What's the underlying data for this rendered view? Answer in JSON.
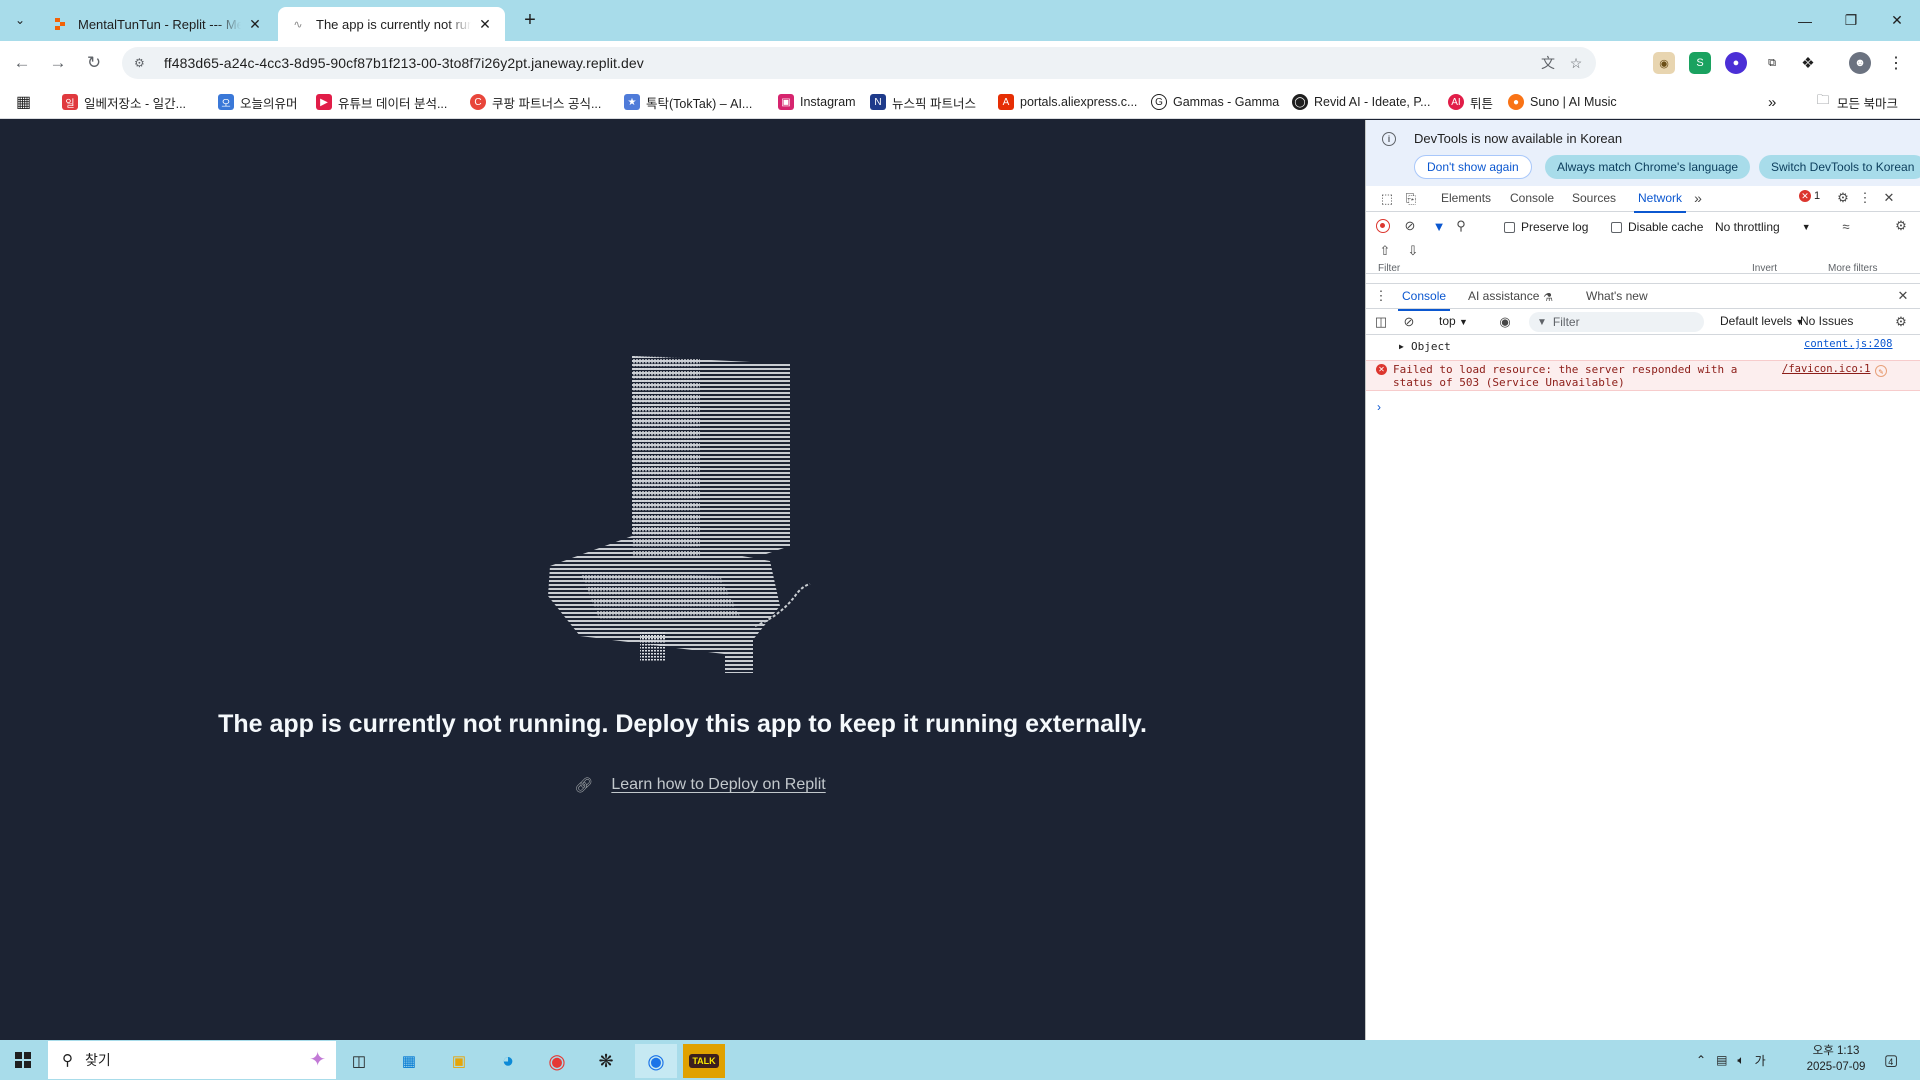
{
  "browser": {
    "tabs": [
      {
        "title": "MentalTunTun - Replit --- MentalTunTun",
        "active": false
      },
      {
        "title": "The app is currently not running",
        "active": true
      }
    ],
    "url": "ff483d65-a24c-4cc3-8d95-90cf87b1f213-00-3to8f7i26y2pt.janeway.replit.dev",
    "bookmarks": [
      "일베저장소 - 일간...",
      "오늘의유머",
      "유튜브 데이터 분석...",
      "쿠팡 파트너스 공식...",
      "톡탁(TokTak) – AI...",
      "Instagram",
      "뉴스픽 파트너스",
      "portals.aliexpress.c...",
      "Gammas - Gamma",
      "Revid AI - Ideate, P...",
      "튀튼",
      "Suno | AI Music"
    ],
    "bookmarks_folder": "모든 북마크"
  },
  "page": {
    "message": "The app is currently not running. Deploy this app to keep it running externally.",
    "link_text": "Learn how to Deploy on Replit"
  },
  "devtools": {
    "banner": {
      "text": "DevTools is now available in Korean",
      "buttons": [
        "Don't show again",
        "Always match Chrome's language",
        "Switch DevTools to Korean"
      ]
    },
    "tabs": [
      "Elements",
      "Console",
      "Sources",
      "Network"
    ],
    "active_tab": "Network",
    "error_count": "1",
    "network": {
      "preserve_log": "Preserve log",
      "disable_cache": "Disable cache",
      "throttling": "No throttling",
      "filter_placeholder": "Filter",
      "invert": "Invert",
      "more_filters": "More filters"
    },
    "drawer_tabs": [
      "Console",
      "AI assistance",
      "What's new"
    ],
    "console": {
      "context": "top",
      "filter_placeholder": "Filter",
      "levels": "Default levels",
      "issues": "No Issues",
      "messages": [
        {
          "type": "log",
          "text": "Object",
          "source": "content.js:208"
        },
        {
          "type": "error",
          "text": "Failed to load resource: the server responded with a status of 503 (Service Unavailable)",
          "source": "/favicon.ico:1"
        }
      ]
    }
  },
  "taskbar": {
    "search_placeholder": "찾기",
    "ime": "가",
    "time": "오후 1:13",
    "date": "2025-07-09",
    "notifications": "4"
  },
  "colors": {
    "page_bg": "#1c2333",
    "chrome_frame": "#a8dcea",
    "accent_blue": "#0b57d0",
    "error_red": "#dc362e"
  }
}
